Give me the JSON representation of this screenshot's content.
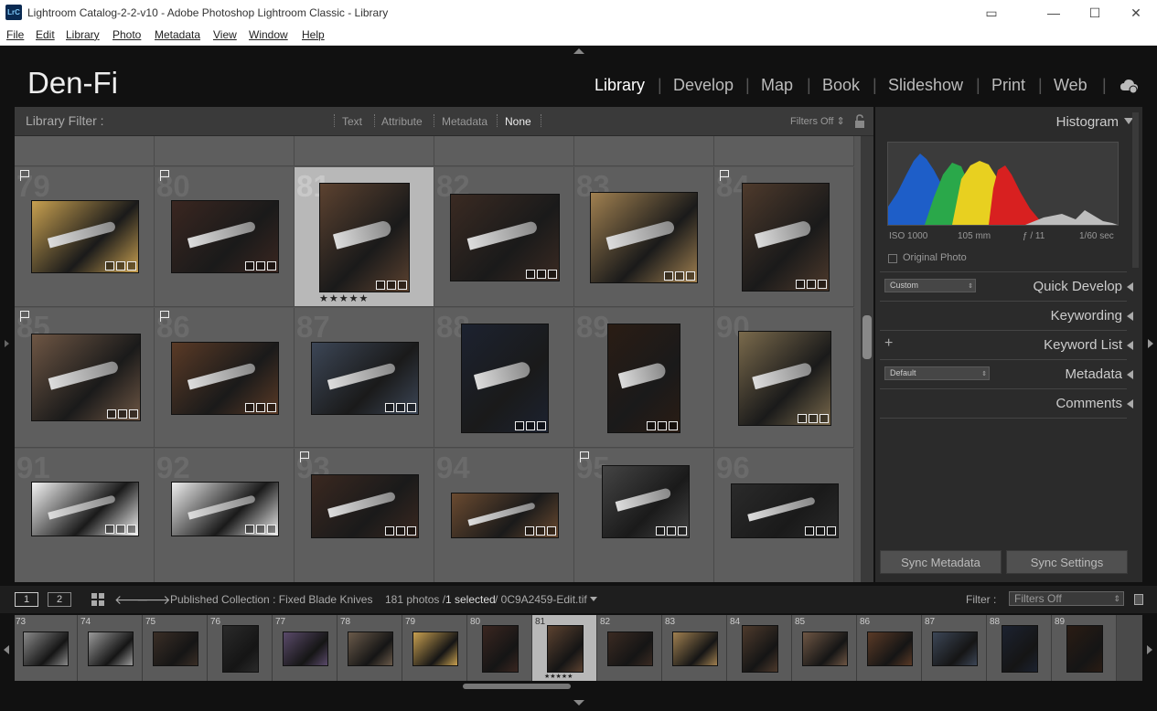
{
  "window": {
    "app_badge": "LrC",
    "title": "Lightroom Catalog-2-2-v10 - Adobe Photoshop Lightroom Classic - Library"
  },
  "menu": [
    "File",
    "Edit",
    "Library",
    "Photo",
    "Metadata",
    "View",
    "Window",
    "Help"
  ],
  "identity_plate": "Den-Fi",
  "modules": [
    "Library",
    "Develop",
    "Map",
    "Book",
    "Slideshow",
    "Print",
    "Web"
  ],
  "active_module": "Library",
  "library_filter": {
    "label": "Library Filter :",
    "options": [
      "Text",
      "Attribute",
      "Metadata",
      "None"
    ],
    "active": "None",
    "filters_status": "Filters Off"
  },
  "grid": {
    "rows": [
      [
        {
          "index": "",
          "flag": false,
          "color": "#7a7a7a"
        },
        {
          "index": "",
          "flag": false,
          "color": "#8a8a8a"
        },
        {
          "index": "",
          "flag": false,
          "color": "#3a2e24"
        },
        {
          "index": "",
          "flag": false,
          "color": "#2a2a2a"
        },
        {
          "index": "",
          "flag": false,
          "color": "#4a3a5a"
        },
        {
          "index": "",
          "flag": false,
          "color": "#6a5a4a"
        }
      ],
      [
        {
          "index": "79",
          "flag": true,
          "color": "#c8a050",
          "selected": false
        },
        {
          "index": "80",
          "flag": true,
          "color": "#3a2620"
        },
        {
          "index": "81",
          "flag": false,
          "color": "#5c4230",
          "selected": true,
          "stars": "★★★★★"
        },
        {
          "index": "82",
          "flag": false,
          "color": "#3a2a22"
        },
        {
          "index": "83",
          "flag": false,
          "color": "#a08050"
        },
        {
          "index": "84",
          "flag": true,
          "color": "#4e3a2c"
        }
      ],
      [
        {
          "index": "85",
          "flag": true,
          "color": "#6e5644"
        },
        {
          "index": "86",
          "flag": true,
          "color": "#5a3a26"
        },
        {
          "index": "87",
          "flag": false,
          "color": "#3c4656"
        },
        {
          "index": "88",
          "flag": false,
          "color": "#1c2230"
        },
        {
          "index": "89",
          "flag": false,
          "color": "#2a1c14"
        },
        {
          "index": "90",
          "flag": false,
          "color": "#7a6a4c"
        }
      ],
      [
        {
          "index": "91",
          "flag": false,
          "color": "#f4f4f4"
        },
        {
          "index": "92",
          "flag": false,
          "color": "#eeeeee"
        },
        {
          "index": "93",
          "flag": true,
          "color": "#3a2820"
        },
        {
          "index": "94",
          "flag": false,
          "color": "#6a4a30"
        },
        {
          "index": "95",
          "flag": true,
          "color": "#444444"
        },
        {
          "index": "96",
          "flag": false,
          "color": "#2a2a2a"
        }
      ]
    ]
  },
  "right_panel": {
    "histogram": {
      "label": "Histogram",
      "iso": "ISO 1000",
      "focal": "105 mm",
      "aperture": "ƒ / 11",
      "shutter": "1/60 sec",
      "original_photo": "Original Photo"
    },
    "quick_develop": {
      "label": "Quick Develop",
      "preset": "Custom"
    },
    "keywording": "Keywording",
    "keyword_list": "Keyword List",
    "metadata": {
      "label": "Metadata",
      "preset": "Default"
    },
    "comments": "Comments",
    "sync_metadata": "Sync Metadata",
    "sync_settings": "Sync Settings"
  },
  "filmstrip_bar": {
    "monitor1": "1",
    "monitor2": "2",
    "source": "Published Collection : Fixed Blade Knives",
    "count": "181 photos /",
    "selected": "1 selected",
    "file": "/ 0C9A2459-Edit.tif",
    "filter_label": "Filter :",
    "filter_value": "Filters Off"
  },
  "filmstrip": [
    {
      "index": "73",
      "color": "#8a8a8a"
    },
    {
      "index": "74",
      "color": "#9a9a9a"
    },
    {
      "index": "75",
      "color": "#3a2e26"
    },
    {
      "index": "76",
      "color": "#2a2a2a"
    },
    {
      "index": "77",
      "color": "#5a4a6a"
    },
    {
      "index": "78",
      "color": "#6a5a4a"
    },
    {
      "index": "79",
      "color": "#c8a050"
    },
    {
      "index": "80",
      "color": "#3a2620"
    },
    {
      "index": "81",
      "color": "#5c4230",
      "selected": true,
      "stars": "★★★★★"
    },
    {
      "index": "82",
      "color": "#3a2a22"
    },
    {
      "index": "83",
      "color": "#a08050"
    },
    {
      "index": "84",
      "color": "#4e3a2c"
    },
    {
      "index": "85",
      "color": "#6e5644"
    },
    {
      "index": "86",
      "color": "#5a3a26"
    },
    {
      "index": "87",
      "color": "#3c4656"
    },
    {
      "index": "88",
      "color": "#1c2230"
    },
    {
      "index": "89",
      "color": "#2a1c14"
    }
  ]
}
